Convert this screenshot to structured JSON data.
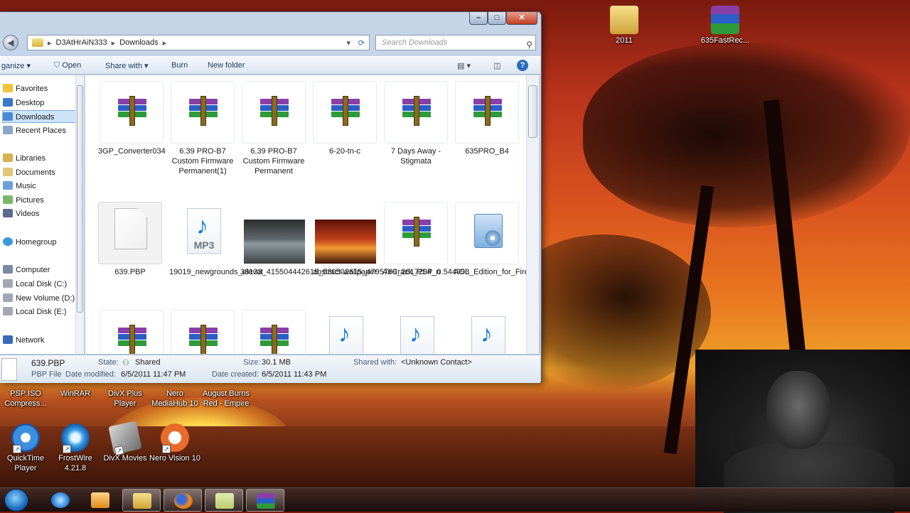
{
  "desktop": {
    "top_icons": [
      {
        "label": "2011"
      },
      {
        "label": "635FastRec..."
      }
    ],
    "left_icons_row1": [
      {
        "label": "PSP ISO Compress..."
      },
      {
        "label": "WinRAR"
      },
      {
        "label": "DivX Plus Player"
      },
      {
        "label": "Nero MediaHub 10"
      },
      {
        "label": "August Burns Red - Empire"
      }
    ],
    "left_icons_row2": [
      {
        "label": "QuickTime Player"
      },
      {
        "label": "FrostWire 4.21.8"
      },
      {
        "label": "DivX Movies"
      },
      {
        "label": "Nero Vision 10"
      }
    ]
  },
  "explorer": {
    "breadcrumb": [
      "D3AtHrAiN333",
      "Downloads"
    ],
    "search_placeholder": "Search Downloads",
    "toolbar": {
      "organize": "ganize",
      "open": "Open",
      "share_with": "Share with",
      "burn": "Burn",
      "new_folder": "New folder"
    },
    "nav": {
      "favorites": "Favorites",
      "desktop": "Desktop",
      "downloads": "Downloads",
      "recent": "Recent Places",
      "libraries": "Libraries",
      "documents": "Documents",
      "music": "Music",
      "pictures": "Pictures",
      "videos": "Videos",
      "homegroup": "Homegroup",
      "computer": "Computer",
      "local_c": "Local Disk (C:)",
      "new_volume": "New Volume (D:)",
      "local_e": "Local Disk (E:)",
      "network": "Network"
    },
    "files_row1": [
      {
        "name": "3GP_Converter034",
        "type": "rar"
      },
      {
        "name": "6.39 PRO-B7 Custom Firmware Permanent(1)",
        "type": "rar"
      },
      {
        "name": "6.39 PRO-B7 Custom Firmware Permanent",
        "type": "rar"
      },
      {
        "name": "6-20-tn-c",
        "type": "rar"
      },
      {
        "name": "7 Days Away - Stigmata",
        "type": "rar"
      },
      {
        "name": "635PRO_B4",
        "type": "rar"
      }
    ],
    "files_row2": [
      {
        "name": "639.PBP",
        "type": "blank"
      },
      {
        "name": "19019_newgrounds_elevat",
        "type": "mp3",
        "badge": "MP3"
      },
      {
        "name": "38133_415504442615_530502615_4795769_2617204_n",
        "type": "image"
      },
      {
        "name": "abstract-wallpaper",
        "type": "image"
      },
      {
        "name": "AirCrack_PSP_0.544993",
        "type": "rar"
      },
      {
        "name": "AOL_Edition_for_Firefox",
        "type": "setup"
      }
    ],
    "details": {
      "filename": "639.PBP",
      "filetype": "PBP File",
      "state_label": "State:",
      "state_value": "Shared",
      "size_label": "Size:",
      "size_value": "30.1 MB",
      "shared_label": "Shared with:",
      "shared_value": "<Unknown Contact>",
      "modified_label": "Date modified:",
      "modified_value": "6/5/2011 11:47 PM",
      "created_label": "Date created:",
      "created_value": "6/5/2011 11:43 PM"
    }
  },
  "colors": {
    "accent": "#1e7fd8",
    "selection": "#cce4f7"
  }
}
